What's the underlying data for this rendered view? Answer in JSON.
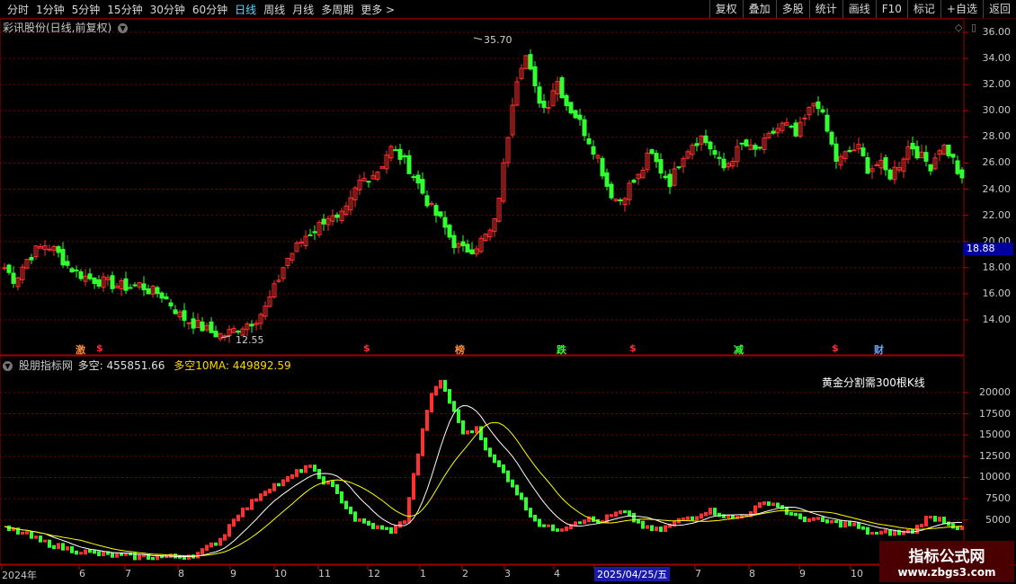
{
  "toolbar": {
    "periods": [
      "分时",
      "1分钟",
      "5分钟",
      "15分钟",
      "30分钟",
      "60分钟",
      "日线",
      "周线",
      "月线",
      "多周期",
      "更多 >"
    ],
    "active_period": "日线",
    "tools": [
      "复权",
      "叠加",
      "多股",
      "统计",
      "画线",
      "F10",
      "标记",
      "+自选",
      "返回"
    ]
  },
  "main_chart": {
    "title": "彩讯股份(日线,前复权)",
    "high_label": "35.70",
    "low_label": "12.55",
    "current_price": "18.88",
    "y_ticks": [
      "36.00",
      "34.00",
      "32.00",
      "30.00",
      "28.00",
      "26.00",
      "24.00",
      "22.00",
      "20.00",
      "18.00",
      "16.00",
      "14.00"
    ],
    "event_markers": [
      {
        "text": "激",
        "color": "#ff8c3c"
      },
      {
        "text": "$",
        "color": "#ff3030"
      },
      {
        "text": "$",
        "color": "#ff3030"
      },
      {
        "text": "榜",
        "color": "#ff8c3c"
      },
      {
        "text": "跌",
        "color": "#30ff30"
      },
      {
        "text": "$",
        "color": "#ff3030"
      },
      {
        "text": "减",
        "color": "#30ff30"
      },
      {
        "text": "$",
        "color": "#ff3030"
      },
      {
        "text": "财",
        "color": "#5fa8ff"
      }
    ]
  },
  "indicator": {
    "name": "股朋指标网",
    "label1": "多空: 455851.66",
    "label2": "多空10MA: 449892.59",
    "note": "黄金分割需300根K线",
    "y_ticks": [
      "20000",
      "17500",
      "15000",
      "12500",
      "10000",
      "7500",
      "5000"
    ]
  },
  "x_axis": {
    "labels": [
      "2024年",
      "6",
      "7",
      "8",
      "9",
      "10",
      "11",
      "12",
      "1",
      "2",
      "3",
      "4",
      "2025/04/25/五",
      "7",
      "8",
      "9",
      "10"
    ]
  },
  "watermark": {
    "line1": "指标公式网",
    "line2": "www.zbgs3.com"
  },
  "colors": {
    "up": "#ff3030",
    "down": "#30ff30",
    "ma1": "#ffffff",
    "ma2": "#ffff00",
    "grid": "#7a0000",
    "border": "#a00000"
  },
  "chart_data": {
    "type": "candlestick",
    "price_close_path": [
      18.0,
      17.0,
      18.5,
      19.3,
      19.8,
      19.2,
      18.2,
      17.6,
      17.2,
      17.0,
      16.8,
      16.6,
      16.5,
      16.7,
      16.2,
      16.0,
      15.2,
      14.2,
      13.8,
      13.4,
      13.0,
      12.8,
      13.2,
      13.6,
      14.0,
      14.8,
      16.5,
      18.5,
      19.5,
      20.5,
      21.0,
      22.0,
      21.5,
      22.5,
      24.5,
      25.0,
      25.5,
      27.2,
      26.5,
      25.5,
      24.0,
      22.5,
      21.5,
      20.0,
      19.3,
      19.5,
      20.2,
      21.0,
      26.0,
      32.0,
      34.5,
      31.5,
      30.0,
      32.5,
      30.5,
      29.5,
      28.0,
      26.5,
      24.0,
      23.0,
      24.2,
      25.0,
      26.8,
      25.5,
      24.5,
      26.5,
      27.5,
      28.0,
      27.0,
      25.5,
      26.5,
      27.5,
      26.8,
      27.5,
      28.5,
      29.0,
      28.0,
      29.5,
      31.0,
      28.5,
      26.0,
      26.8,
      27.2,
      25.5,
      26.0,
      25.0,
      26.0,
      27.5,
      26.5,
      25.8,
      27.5,
      26.5,
      24.5
    ],
    "indicator_path": [
      4000,
      3700,
      3200,
      2500,
      2100,
      1700,
      1400,
      1200,
      1000,
      900,
      800,
      700,
      700,
      700,
      700,
      800,
      1100,
      2000,
      3000,
      5500,
      6500,
      8000,
      9000,
      9500,
      10500,
      11500,
      10000,
      9000,
      7000,
      5000,
      4500,
      4000,
      3800,
      5000,
      12000,
      19000,
      21500,
      18000,
      15000,
      16000,
      12500,
      11000,
      9000,
      6500,
      4700,
      4000,
      4100,
      4800,
      5200,
      4800,
      5500,
      6000,
      5000,
      4000,
      3800,
      4500,
      5200,
      5500,
      6200,
      5800,
      5200,
      5600,
      6500,
      7200,
      6600,
      5500,
      5200,
      5000,
      4800,
      4600,
      4500,
      3700,
      3400,
      3600,
      3500,
      3800,
      5200,
      5300,
      4600,
      3900
    ],
    "ylim_price": [
      12.5,
      36.5
    ],
    "ylim_indicator": [
      0,
      22000
    ]
  }
}
